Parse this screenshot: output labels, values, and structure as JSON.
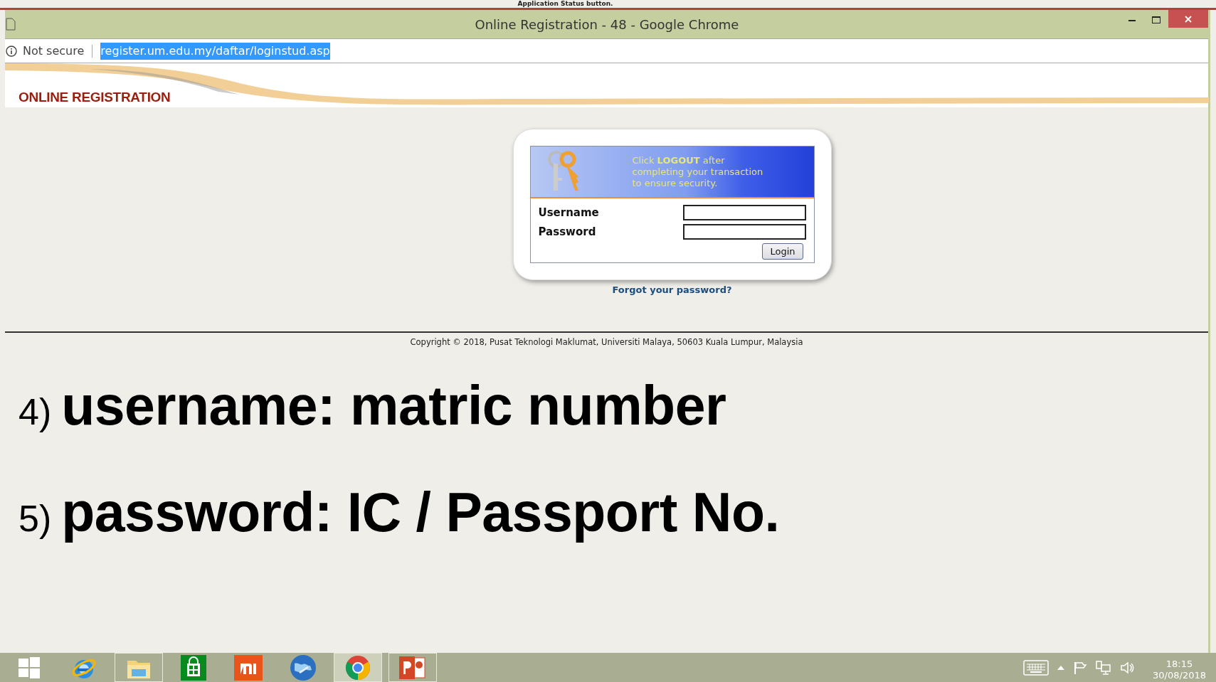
{
  "overlay_caption": "Application Status button.",
  "window": {
    "title": "Online Registration - 48 - Google Chrome"
  },
  "address_bar": {
    "security": "Not secure",
    "url": "register.um.edu.my/daftar/loginstud.asp",
    "url_selected": true
  },
  "site": {
    "title": "ONLINE REGISTRATION"
  },
  "login": {
    "banner_lines": [
      "Click **LOGOUT** after",
      "completing your transaction",
      "to ensure security."
    ],
    "fields": [
      {
        "label": "Username"
      },
      {
        "label": "Password"
      }
    ],
    "button": "Login",
    "forgot_link": "Forgot your password?"
  },
  "footer": {
    "copyright": "Copyright © 2018, Pusat Teknologi Maklumat, Universiti Malaya, 50603 Kuala Lumpur, Malaysia"
  },
  "instructions": [
    {
      "number": "4)",
      "text": "username: matric number"
    },
    {
      "number": "5)",
      "text": "password: IC / Passport No."
    }
  ],
  "taskbar": {
    "apps": [
      {
        "kind": "start",
        "running": false,
        "selected": false
      },
      {
        "kind": "ie",
        "running": false,
        "selected": false
      },
      {
        "kind": "explorer",
        "running": true,
        "selected": false
      },
      {
        "kind": "store",
        "running": false,
        "selected": false
      },
      {
        "kind": "mi",
        "running": false,
        "selected": false
      },
      {
        "kind": "globe",
        "running": false,
        "selected": false
      },
      {
        "kind": "chrome",
        "running": true,
        "selected": true
      },
      {
        "kind": "powerpoint",
        "running": true,
        "selected": false
      }
    ],
    "time": "18:15",
    "date": "30/08/2018"
  }
}
